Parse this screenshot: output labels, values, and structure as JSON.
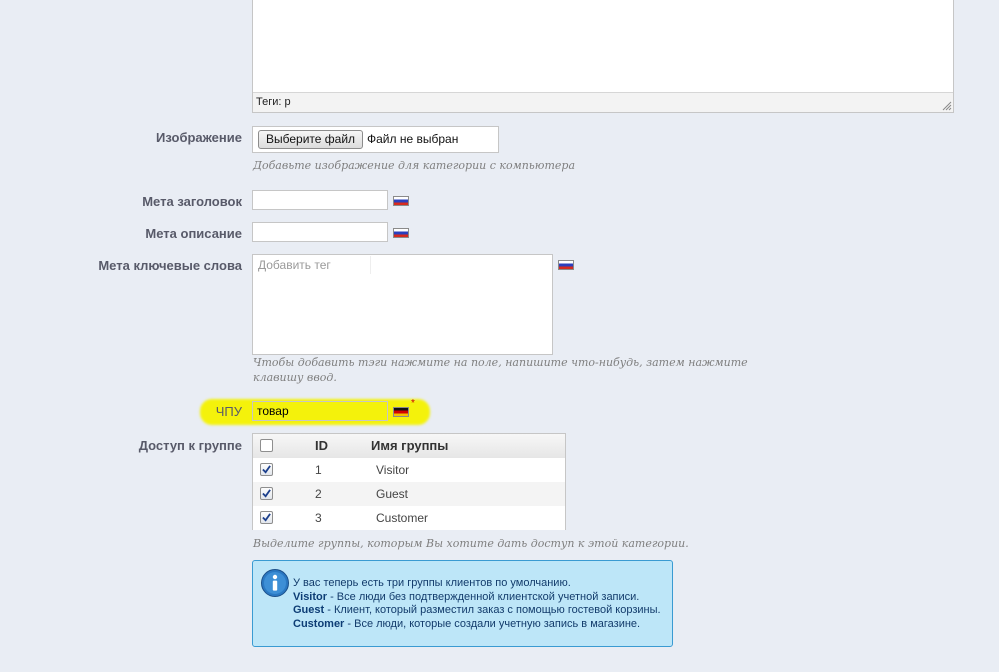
{
  "editor": {
    "status_text": "Теги: p"
  },
  "image": {
    "label": "Изображение",
    "button_label": "Выберите файл",
    "file_status": "Файл не выбран",
    "hint": "Добавьте изображение для категории с компьютера"
  },
  "meta_title": {
    "label": "Мета заголовок",
    "value": "",
    "flag": "ru-flag-icon"
  },
  "meta_description": {
    "label": "Мета описание",
    "value": "",
    "flag": "ru-flag-icon"
  },
  "meta_keywords": {
    "label": "Мета ключевые слова",
    "placeholder": "Добавить тег",
    "hint_line1": "Чтобы добавить тэги нажмите на поле, напишите что-нибудь, затем нажмите",
    "hint_line2": "клавишу ввод."
  },
  "friendly_url": {
    "label": "ЧПУ",
    "value": "товар",
    "required_mark": "*",
    "flag": "de-flag-icon"
  },
  "group_access": {
    "label": "Доступ к группе",
    "columns": [
      "ID",
      "Имя группы"
    ],
    "rows": [
      {
        "id": "1",
        "name": "Visitor",
        "checked": true
      },
      {
        "id": "2",
        "name": "Guest",
        "checked": true
      },
      {
        "id": "3",
        "name": "Customer",
        "checked": true
      }
    ],
    "hint": "Выделите группы, которым Вы хотите дать доступ к этой категории."
  },
  "info": {
    "intro": "У вас теперь есть три группы клиентов по умолчанию.",
    "items": [
      {
        "name": "Visitor",
        "desc": " - Все люди без подтвержденной клиентской учетной записи."
      },
      {
        "name": "Guest",
        "desc": " - Клиент, который разместил заказ с помощью гостевой корзины."
      },
      {
        "name": "Customer",
        "desc": " - Все люди, которые создали учетную запись в магазине."
      }
    ]
  },
  "colors": {
    "highlight": "#f4f20b",
    "info_bg": "#bde6f8",
    "info_border": "#3a9bd2",
    "label": "#585a69"
  }
}
